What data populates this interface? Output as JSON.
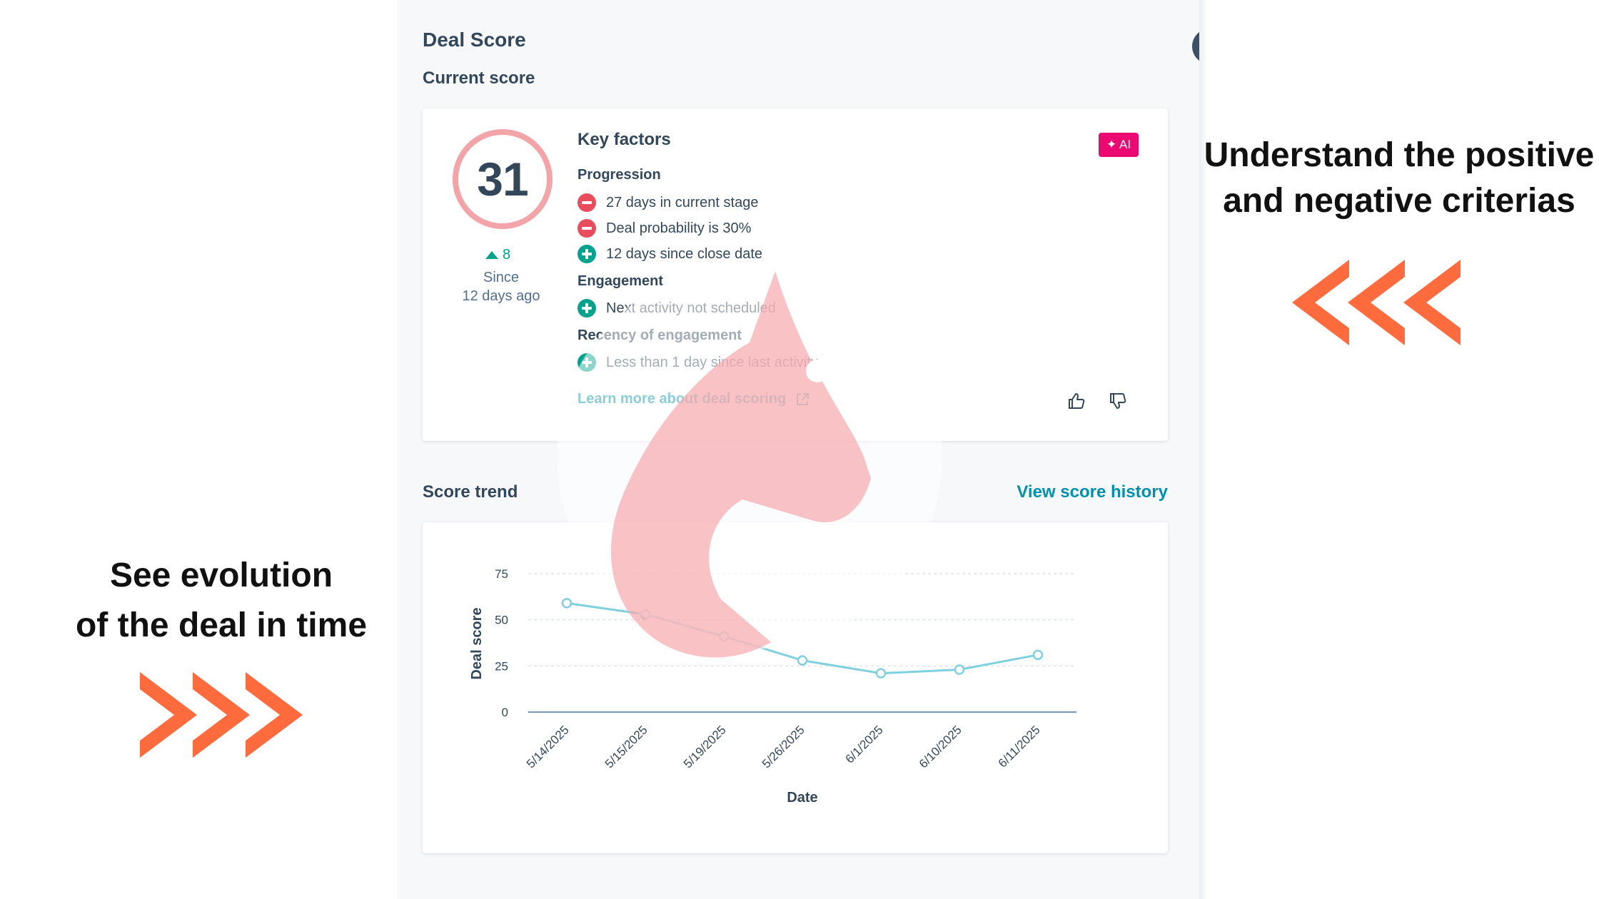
{
  "header": {
    "title": "Deal Score",
    "subtitle": "Current score"
  },
  "score": {
    "value": "31",
    "delta": "8",
    "since_line1": "Since",
    "since_line2": "12 days ago"
  },
  "key_factors": {
    "title": "Key factors",
    "ai_badge": "✦ AI",
    "groups": [
      {
        "heading": "Progression",
        "items": [
          {
            "text": "27 days in current stage",
            "polarity": "negative"
          },
          {
            "text": "Deal probability is 30%",
            "polarity": "negative"
          },
          {
            "text": "12 days since close date",
            "polarity": "positive"
          }
        ]
      },
      {
        "heading": "Engagement",
        "items": [
          {
            "text": "Next activity not scheduled",
            "polarity": "positive"
          }
        ]
      },
      {
        "heading": "Recency of engagement",
        "items": [
          {
            "text": "Less than 1 day since last activity",
            "polarity": "positive"
          }
        ]
      }
    ],
    "learn_more": "Learn more about deal scoring",
    "icons": [
      "external-link-icon",
      "thumbs-up-icon",
      "thumbs-down-icon"
    ]
  },
  "score_trend": {
    "title": "Score trend",
    "view_history": "View score history"
  },
  "chart_data": {
    "type": "line",
    "x": [
      "5/14/2025",
      "5/15/2025",
      "5/19/2025",
      "5/26/2025",
      "6/1/2025",
      "6/10/2025",
      "6/11/2025"
    ],
    "series": [
      {
        "values": [
          59,
          53,
          41,
          28,
          21,
          23,
          31
        ]
      }
    ],
    "xlabel": "Date",
    "ylabel": "Deal score",
    "yticks": [
      0,
      25,
      50,
      75
    ],
    "ylim": [
      0,
      75
    ],
    "grid": "horizontal dashed",
    "line_color": "#7fd1de"
  },
  "annotations": {
    "right_line1": "Understand the positive",
    "right_line2": "and negative criterias",
    "left_line1": "See evolution",
    "left_line2": "of the deal in time"
  },
  "colors": {
    "accent_link": "#0091ae",
    "negative": "#e94d5d",
    "positive": "#00a38d",
    "arrows": "#ff6b3d",
    "ai_badge": "#ea0a72"
  }
}
